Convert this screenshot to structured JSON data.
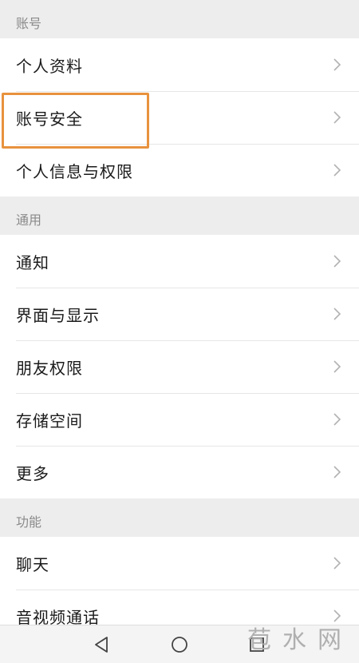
{
  "sections": [
    {
      "title": "账号",
      "items": [
        "个人资料",
        "账号安全",
        "个人信息与权限"
      ]
    },
    {
      "title": "通用",
      "items": [
        "通知",
        "界面与显示",
        "朋友权限",
        "存储空间",
        "更多"
      ]
    },
    {
      "title": "功能",
      "items": [
        "聊天",
        "音视频通话"
      ]
    }
  ],
  "highlight_color": "#e8923e",
  "navbar": {
    "icons": [
      "back-triangle-icon",
      "home-circle-icon",
      "recent-square-icon"
    ]
  },
  "watermark": "苞水网"
}
